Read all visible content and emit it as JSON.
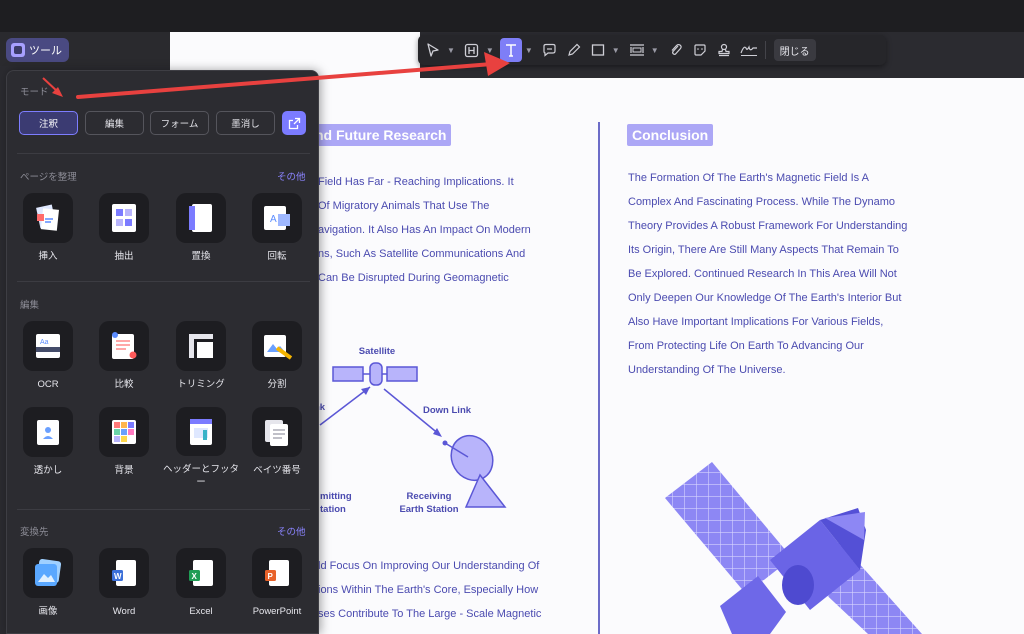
{
  "app": {
    "tools_button_label": "ツール"
  },
  "toolbar": {
    "items": [
      {
        "icon": "cursor-icon",
        "has_caret": true
      },
      {
        "icon": "highlight-icon",
        "has_caret": true
      },
      {
        "icon": "text-icon",
        "has_caret": true,
        "active": true
      },
      {
        "icon": "comment-icon",
        "has_caret": false
      },
      {
        "icon": "pencil-icon",
        "has_caret": false
      },
      {
        "icon": "rectangle-icon",
        "has_caret": true
      },
      {
        "icon": "measure-icon",
        "has_caret": true
      },
      {
        "icon": "attachment-icon",
        "has_caret": false
      },
      {
        "icon": "sticker-icon",
        "has_caret": false
      },
      {
        "icon": "stamp-icon",
        "has_caret": false
      },
      {
        "icon": "signature-icon",
        "has_caret": false
      }
    ],
    "close_label": "閉じる"
  },
  "panel": {
    "mode_label": "モード",
    "modes": [
      {
        "label": "注釈",
        "active": true
      },
      {
        "label": "編集",
        "active": false
      },
      {
        "label": "フォーム",
        "active": false
      },
      {
        "label": "墨消し",
        "active": false
      }
    ],
    "organize": {
      "label": "ページを整理",
      "more": "その他",
      "items": [
        {
          "label": "挿入",
          "icon": "insert-pages-icon"
        },
        {
          "label": "抽出",
          "icon": "extract-pages-icon"
        },
        {
          "label": "置換",
          "icon": "replace-pages-icon"
        },
        {
          "label": "回転",
          "icon": "rotate-pages-icon"
        }
      ]
    },
    "edit": {
      "label": "編集",
      "items": [
        {
          "label": "OCR",
          "icon": "ocr-icon"
        },
        {
          "label": "比較",
          "icon": "compare-icon"
        },
        {
          "label": "トリミング",
          "icon": "crop-icon"
        },
        {
          "label": "分割",
          "icon": "split-icon"
        },
        {
          "label": "透かし",
          "icon": "watermark-icon"
        },
        {
          "label": "背景",
          "icon": "background-icon"
        },
        {
          "label": "ヘッダーとフッター",
          "icon": "header-footer-icon"
        },
        {
          "label": "ベイツ番号",
          "icon": "bates-number-icon"
        }
      ]
    },
    "convert": {
      "label": "変換先",
      "more": "その他",
      "items": [
        {
          "label": "画像",
          "icon": "image-file-icon"
        },
        {
          "label": "Word",
          "icon": "word-file-icon"
        },
        {
          "label": "Excel",
          "icon": "excel-file-icon"
        },
        {
          "label": "PowerPoint",
          "icon": "powerpoint-file-icon"
        }
      ]
    }
  },
  "document": {
    "left_heading": "nd Future Research",
    "left_lines": [
      "Field Has Far - Reaching Implications. It",
      "Of Migratory Animals That Use The",
      "avigation. It Also Has An Impact On Modern",
      "ns, Such As Satellite Communications And",
      "Can Be Disrupted During Geomagnetic"
    ],
    "diagram": {
      "satellite": "Satellite",
      "down_link": "Down Link",
      "up_link_partial": "nk",
      "transmit_line1": "mitting",
      "transmit_line2": "tation",
      "receive_line1": "Receiving",
      "receive_line2": "Earth Station"
    },
    "left_bottom_lines": [
      "ld Focus On Improving Our Understanding Of",
      "ions Within The Earth's Core, Especially How",
      "ses Contribute To The Large - Scale Magnetic"
    ],
    "right_heading": "Conclusion",
    "right_lines": [
      "The Formation Of The Earth's Magnetic Field Is A",
      "Complex And Fascinating Process. While The Dynamo",
      "Theory Provides A Robust Framework For Understanding",
      "Its Origin, There Are Still Many Aspects That Remain To",
      "Be Explored. Continued Research In This Area Will Not",
      "Only Deepen Our Knowledge Of The Earth's Interior But",
      "Also Have Important Implications For Various Fields,",
      "From Protecting Life On Earth To Advancing Our",
      "Understanding Of The Universe."
    ]
  },
  "colors": {
    "accent": "#7b7bff",
    "arrow": "#e8413f",
    "doc_text": "#4b4bb0",
    "heading_bg": "#aca7f6"
  }
}
